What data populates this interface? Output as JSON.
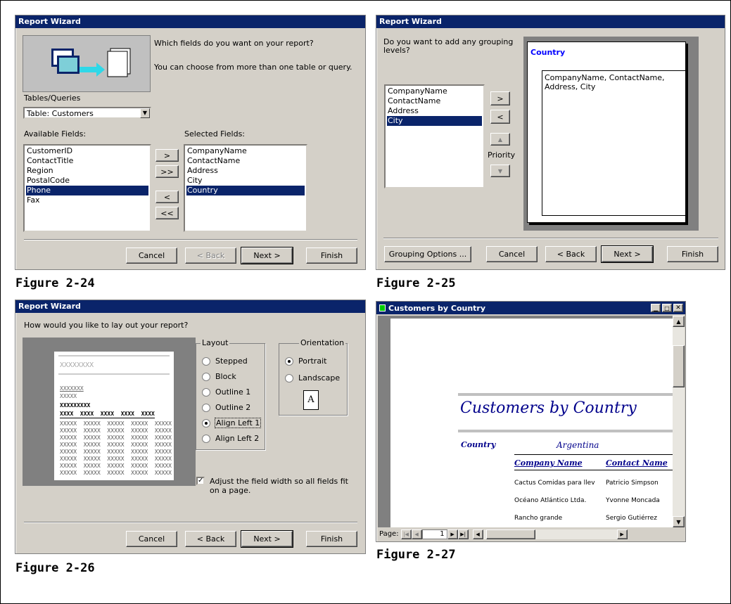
{
  "fig24": {
    "title": "Report Wizard",
    "question": "Which fields do you want on your report?",
    "hint": "You can choose from more than one table or query.",
    "tables_label": "Tables/Queries",
    "table_value": "Table: Customers",
    "available_label": "Available Fields:",
    "selected_label": "Selected Fields:",
    "available": [
      "CustomerID",
      "ContactTitle",
      "Region",
      "PostalCode",
      "Phone",
      "Fax"
    ],
    "selected": [
      "CompanyName",
      "ContactName",
      "Address",
      "City",
      "Country"
    ],
    "add": ">",
    "add_all": ">>",
    "remove": "<",
    "remove_all": "<<",
    "cancel": "Cancel",
    "back": "< Back",
    "next": "Next >",
    "finish": "Finish",
    "caption": "Figure 2-24"
  },
  "fig25": {
    "title": "Report Wizard",
    "question": "Do you want to add any grouping levels?",
    "fields": [
      "CompanyName",
      "ContactName",
      "Address",
      "City"
    ],
    "add": ">",
    "remove": "<",
    "priority": "Priority",
    "group_header": "Country",
    "group_detail": "CompanyName, ContactName, Address, City",
    "grouping_options": "Grouping Options ...",
    "cancel": "Cancel",
    "back": "< Back",
    "next": "Next >",
    "finish": "Finish",
    "caption": "Figure 2-25"
  },
  "fig26": {
    "title": "Report Wizard",
    "question": "How would you like to lay out your report?",
    "layout_label": "Layout",
    "layouts": [
      "Stepped",
      "Block",
      "Outline 1",
      "Outline 2",
      "Align Left 1",
      "Align Left 2"
    ],
    "orientation_label": "Orientation",
    "orientations": [
      "Portrait",
      "Landscape"
    ],
    "page_icon": "A",
    "adjust": "Adjust the field width so all fields fit on a page.",
    "mock_title": "XXXXXXXX",
    "mock_rows": [
      "XXXXXXX",
      "XXXXX",
      "XXXXXXXXX",
      "XXXX  XXXX  XXXX  XXXX  XXXX"
    ],
    "mock_grid_row": "XXXXX  XXXXX  XXXXX  XXXXX  XXXXX",
    "cancel": "Cancel",
    "back": "< Back",
    "next": "Next >",
    "finish": "Finish",
    "caption": "Figure 2-26"
  },
  "fig27": {
    "title": "Customers by Country",
    "report_title": "Customers by Country",
    "country_label": "Country",
    "country_value": "Argentina",
    "col_company": "Company Name",
    "col_contact": "Contact Name",
    "rows": [
      {
        "company": "Cactus Comidas para llev",
        "contact": "Patricio Simpson"
      },
      {
        "company": "Océano Atlántico Ltda.",
        "contact": "Yvonne Moncada"
      },
      {
        "company": "Rancho grande",
        "contact": "Sergio Gutiérrez"
      }
    ],
    "page_label": "Page:",
    "page_value": "1",
    "caption": "Figure 2-27"
  }
}
